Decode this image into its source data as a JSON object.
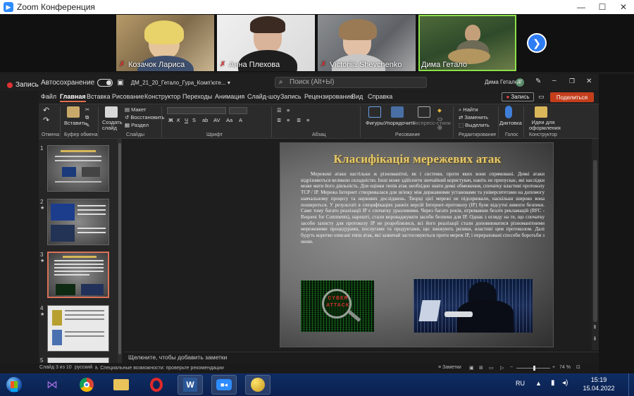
{
  "zoom": {
    "window_title": "Zoom Конференция",
    "participants": [
      {
        "name": "Козачок Лариса",
        "muted": true
      },
      {
        "name": "Анна Плехова",
        "muted": true
      },
      {
        "name": "Victoriia Shevchenko",
        "muted": true
      },
      {
        "name": "Дима Гетало",
        "muted": false
      }
    ]
  },
  "ppt": {
    "record_label": "Запись",
    "autosave_label": "Автосохранение",
    "file_name": "ДМ_21_20_Гетало_Гура_Комп'юте... ▾",
    "search_placeholder": "Поиск (Alt+Ы)",
    "user_name": "Дима Гетало",
    "user_initials": "ДГ",
    "record_button": "Запись",
    "share_button": "Поделиться",
    "menu": [
      "Файл",
      "Главная",
      "Вставка",
      "Рисование",
      "Конструктор",
      "Переходы",
      "Анимация",
      "Слайд-шоу",
      "Запись",
      "Рецензирование",
      "Вид",
      "Справка"
    ],
    "ribbon": {
      "undo_group": "Отмена",
      "paste": "Вставить",
      "clipboard_group": "Буфер обмена",
      "new_slide": "Создать слайд",
      "layout": "Макет",
      "reset": "Восстановить",
      "section": "Раздел",
      "slides_group": "Слайды",
      "font_group": "Шрифт",
      "paragraph_group": "Абзац",
      "shapes": "Фигуры",
      "arrange": "Упорядочить",
      "quick_styles": "Экспресс-стили",
      "drawing_group": "Рисование",
      "find": "Найти",
      "replace": "Заменить",
      "select": "Выделить",
      "editing_group": "Редактирование",
      "dictate": "Диктовка",
      "voice_group": "Голос",
      "designer": "Идеи для оформления",
      "designer_group": "Конструктор"
    },
    "thumbnails": [
      {
        "num": "1",
        "star": false
      },
      {
        "num": "2",
        "star": true
      },
      {
        "num": "3",
        "star": true
      },
      {
        "num": "4",
        "star": true
      },
      {
        "num": "5",
        "star": false
      }
    ],
    "slide": {
      "title": "Класифікація мережевих атак",
      "body": "Мережеві атаки настільки ж різноманітні, як і системи, проти яких вони спрямовані. Деякі атаки відрізняються великою складністю. Інші може здійснити звичайний користувач, навіть не припускає, які наслідки може мати його діяльність. Для оцінки типів атак необхідно знати деякі обмеження, спочатку властиві протоколу TCP / IP. Мережа Інтернет створювалася для зв'язку між державними установами та університетами на допомогу навчальному процесу та наукових досліджень. Творці цієї мережі не підозрювали, наскільки широко вона пошириться. У результаті в специфікаціях ранніх версій Інтернет-протоколу (IP) були відсутні вимоги безпеки. Саме тому багато реалізації IP є спочатку уразливими. Через багато років, отримавши безліч рекламацій (RFC - Request for Comments), нарешті, стали впроваджувати засоби безпеки для IP. Однак з огляду на те, що спочатку засоби захисту для протоколу IP не розроблялися, всі його реалізації стали доповнюватися різноманітними мережевими процедурами, послугами та продуктами, що знижують ризики, властиві цим протоколом. Далі будуть коротко описані типи атак, які зазвичай застосовуються проти мереж IP, і перераховані способи боротьби з ними.",
      "image1_text_1": "CYBER",
      "image1_text_2": "ATTACK"
    },
    "notes_placeholder": "Щелкните, чтобы добавить заметки",
    "status": {
      "slide_counter": "Слайд 3 из 10",
      "language": "русский",
      "accessibility": "Специальные возможности: проверьте рекомендации",
      "notes": "Заметки",
      "zoom": "74 %"
    }
  },
  "taskbar": {
    "lang": "RU",
    "time": "15:19",
    "date": "15.04.2022"
  }
}
